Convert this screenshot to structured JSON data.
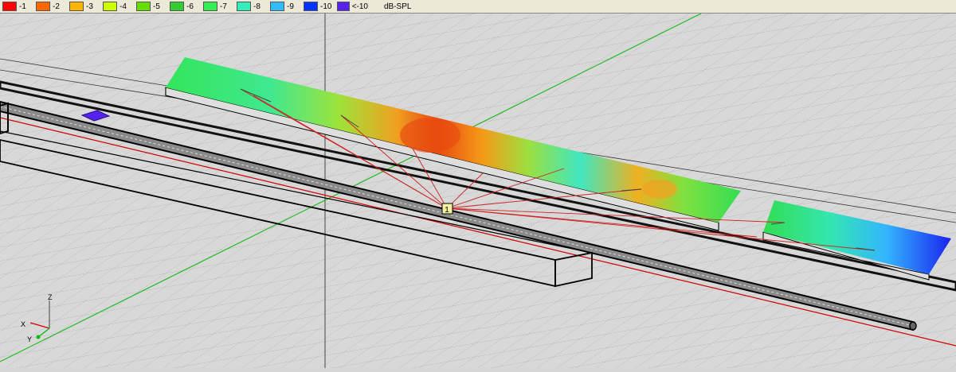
{
  "legend": {
    "items": [
      {
        "label": "-1",
        "color": "#ff0000"
      },
      {
        "label": "-2",
        "color": "#ff6600"
      },
      {
        "label": "-3",
        "color": "#ffb400"
      },
      {
        "label": "-4",
        "color": "#ccff00"
      },
      {
        "label": "-5",
        "color": "#66dd00"
      },
      {
        "label": "-6",
        "color": "#33cc33"
      },
      {
        "label": "-7",
        "color": "#33ee55"
      },
      {
        "label": "-8",
        "color": "#33eebb"
      },
      {
        "label": "-9",
        "color": "#33bbff"
      },
      {
        "label": "-10",
        "color": "#0033ff"
      },
      {
        "label": "<-10",
        "color": "#5522ee"
      }
    ],
    "unit": "dB-SPL"
  },
  "scene": {
    "source_label": "1",
    "axes": {
      "z": "Z",
      "x": "X",
      "y": "Y"
    },
    "colors": {
      "x_axis": "#d00000",
      "y_axis": "#00bb00",
      "z_axis": "#444444",
      "rays": "#cc2222"
    }
  }
}
